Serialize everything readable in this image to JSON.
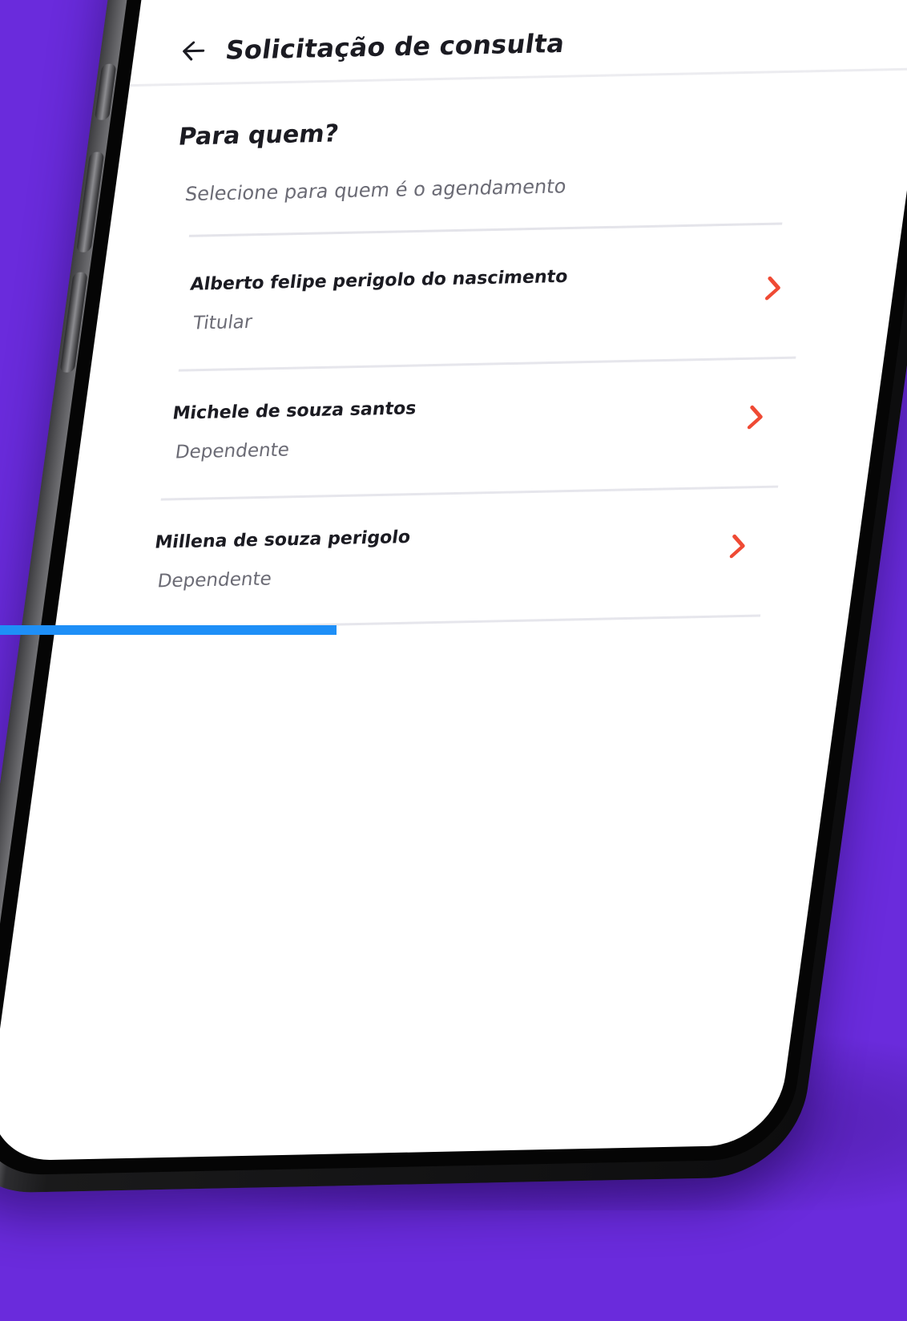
{
  "app_bar": {
    "title": "Solicitação de consulta"
  },
  "section": {
    "title": "Para quem?",
    "subtitle": "Selecione para quem é o agendamento"
  },
  "people": [
    {
      "name": "Alberto felipe perigolo do nascimento",
      "role": "Titular"
    },
    {
      "name": "Michele de souza santos",
      "role": "Dependente"
    },
    {
      "name": "Millena de souza perigolo",
      "role": "Dependente"
    }
  ],
  "icons": {
    "back": "arrow-left-icon",
    "chevron": "chevron-right-icon"
  },
  "colors": {
    "background": "#6a2bdc",
    "accent_blue": "#1e8ff7",
    "accent_purple_line": "#8a56ff",
    "chevron": "#ef4a34",
    "text_primary": "#1b1b22",
    "text_secondary": "#6b6b75"
  }
}
